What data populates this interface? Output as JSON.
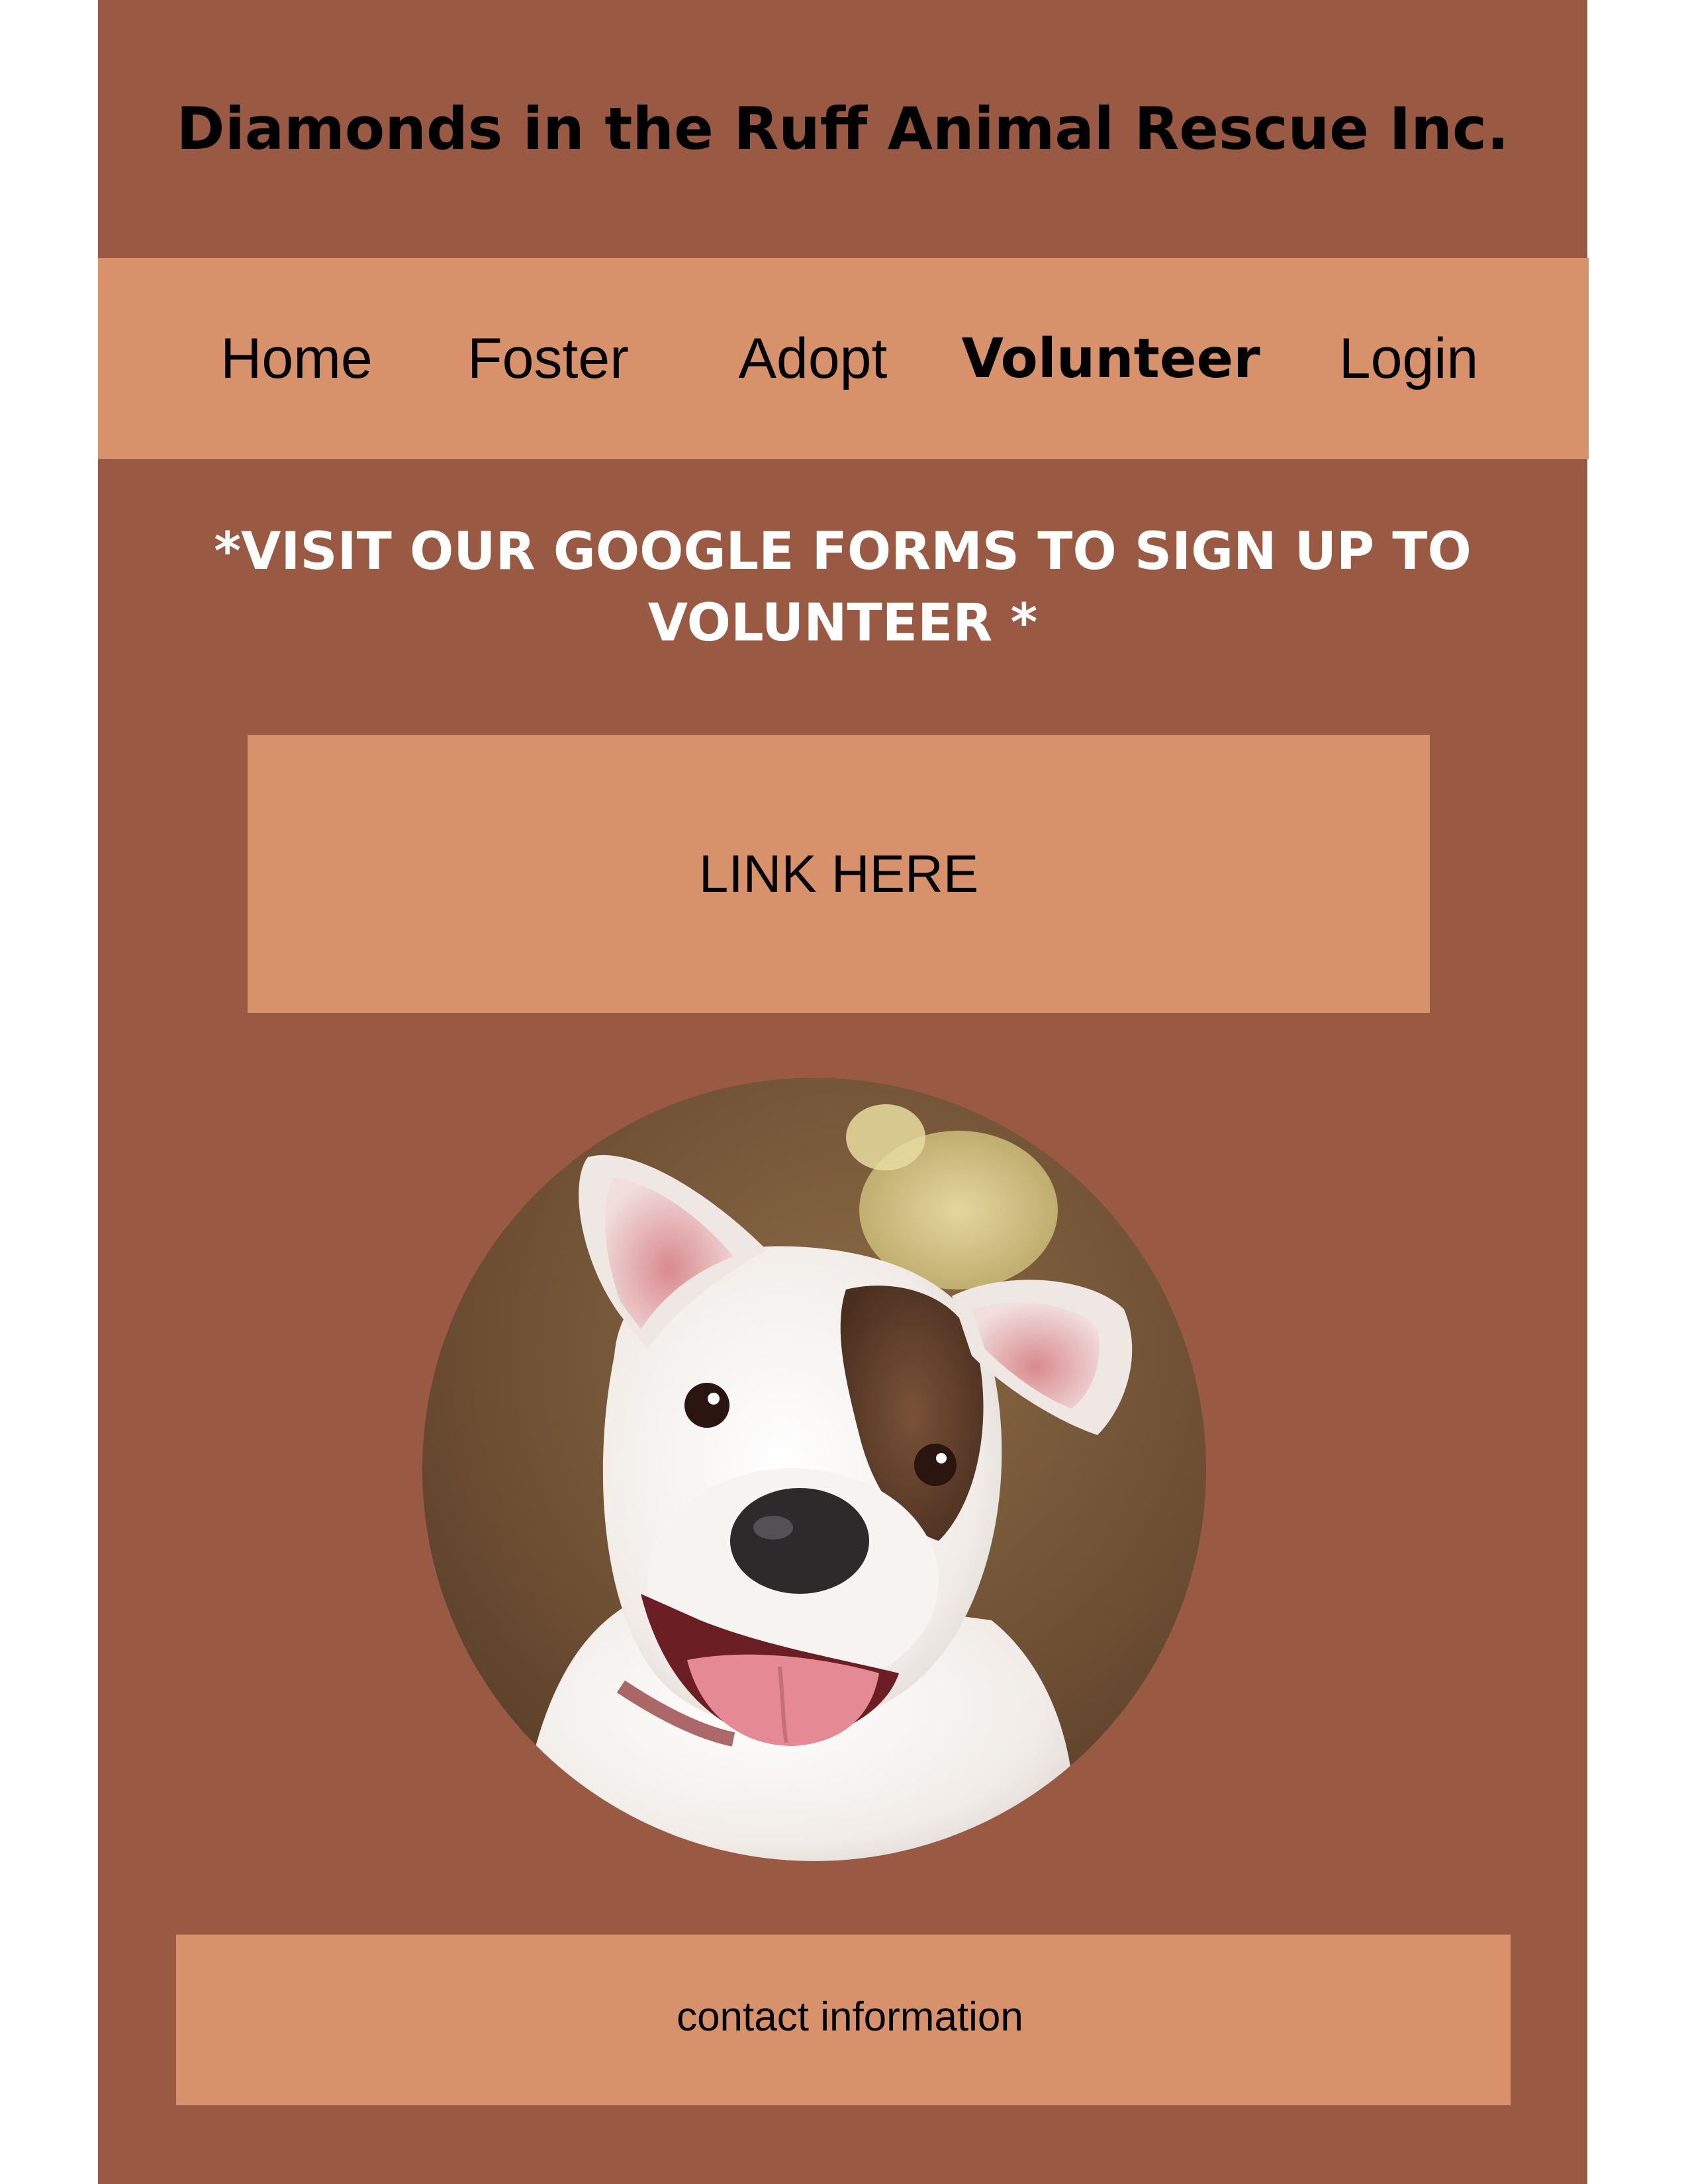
{
  "site": {
    "title": "Diamonds in the Ruff Animal Rescue Inc."
  },
  "nav": {
    "items": [
      {
        "label": "Home",
        "active": false
      },
      {
        "label": "Foster",
        "active": false
      },
      {
        "label": "Adopt",
        "active": false
      },
      {
        "label": "Volunteer",
        "active": true
      },
      {
        "label": "Login",
        "active": false
      }
    ]
  },
  "main": {
    "notice_line1": "*VISIT OUR GOOGLE FORMS TO SIGN UP TO",
    "notice_line2": "VOLUNTEER *",
    "link_label": "LINK HERE"
  },
  "footer": {
    "label": "contact information"
  },
  "colors": {
    "dark": "#9a5942",
    "light": "#d7916b"
  }
}
